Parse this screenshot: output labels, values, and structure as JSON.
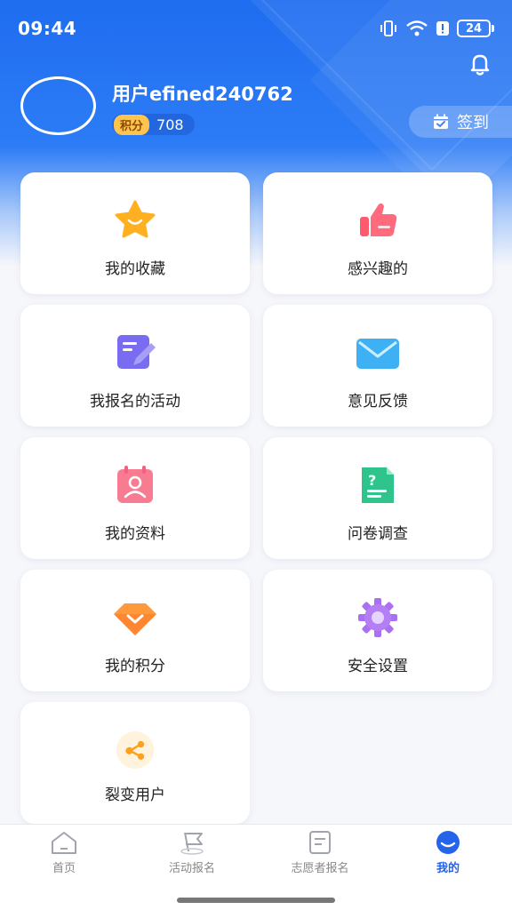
{
  "status_bar": {
    "time": "09:44",
    "battery": "24"
  },
  "profile": {
    "username": "用户efined240762",
    "points_tag": "积分",
    "points_value": "708",
    "checkin_label": "签到"
  },
  "menu": [
    {
      "label": "我的收藏",
      "icon": "star-icon"
    },
    {
      "label": "感兴趣的",
      "icon": "thumbs-up-icon"
    },
    {
      "label": "我报名的活动",
      "icon": "edit-note-icon"
    },
    {
      "label": "意见反馈",
      "icon": "mail-icon"
    },
    {
      "label": "我的资料",
      "icon": "profile-card-icon"
    },
    {
      "label": "问卷调查",
      "icon": "questionnaire-icon"
    },
    {
      "label": "我的积分",
      "icon": "diamond-icon"
    },
    {
      "label": "安全设置",
      "icon": "gear-icon"
    },
    {
      "label": "裂变用户",
      "icon": "share-icon"
    }
  ],
  "tabbar": [
    {
      "label": "首页",
      "icon": "home-icon",
      "active": false
    },
    {
      "label": "活动报名",
      "icon": "flag-icon",
      "active": false
    },
    {
      "label": "志愿者报名",
      "icon": "document-icon",
      "active": false
    },
    {
      "label": "我的",
      "icon": "user-face-icon",
      "active": true
    }
  ],
  "colors": {
    "primary": "#2563eb",
    "header_gradient_top": "#1f6df0",
    "points_tag": "#ffc44d",
    "inactive_tab": "#888888"
  }
}
